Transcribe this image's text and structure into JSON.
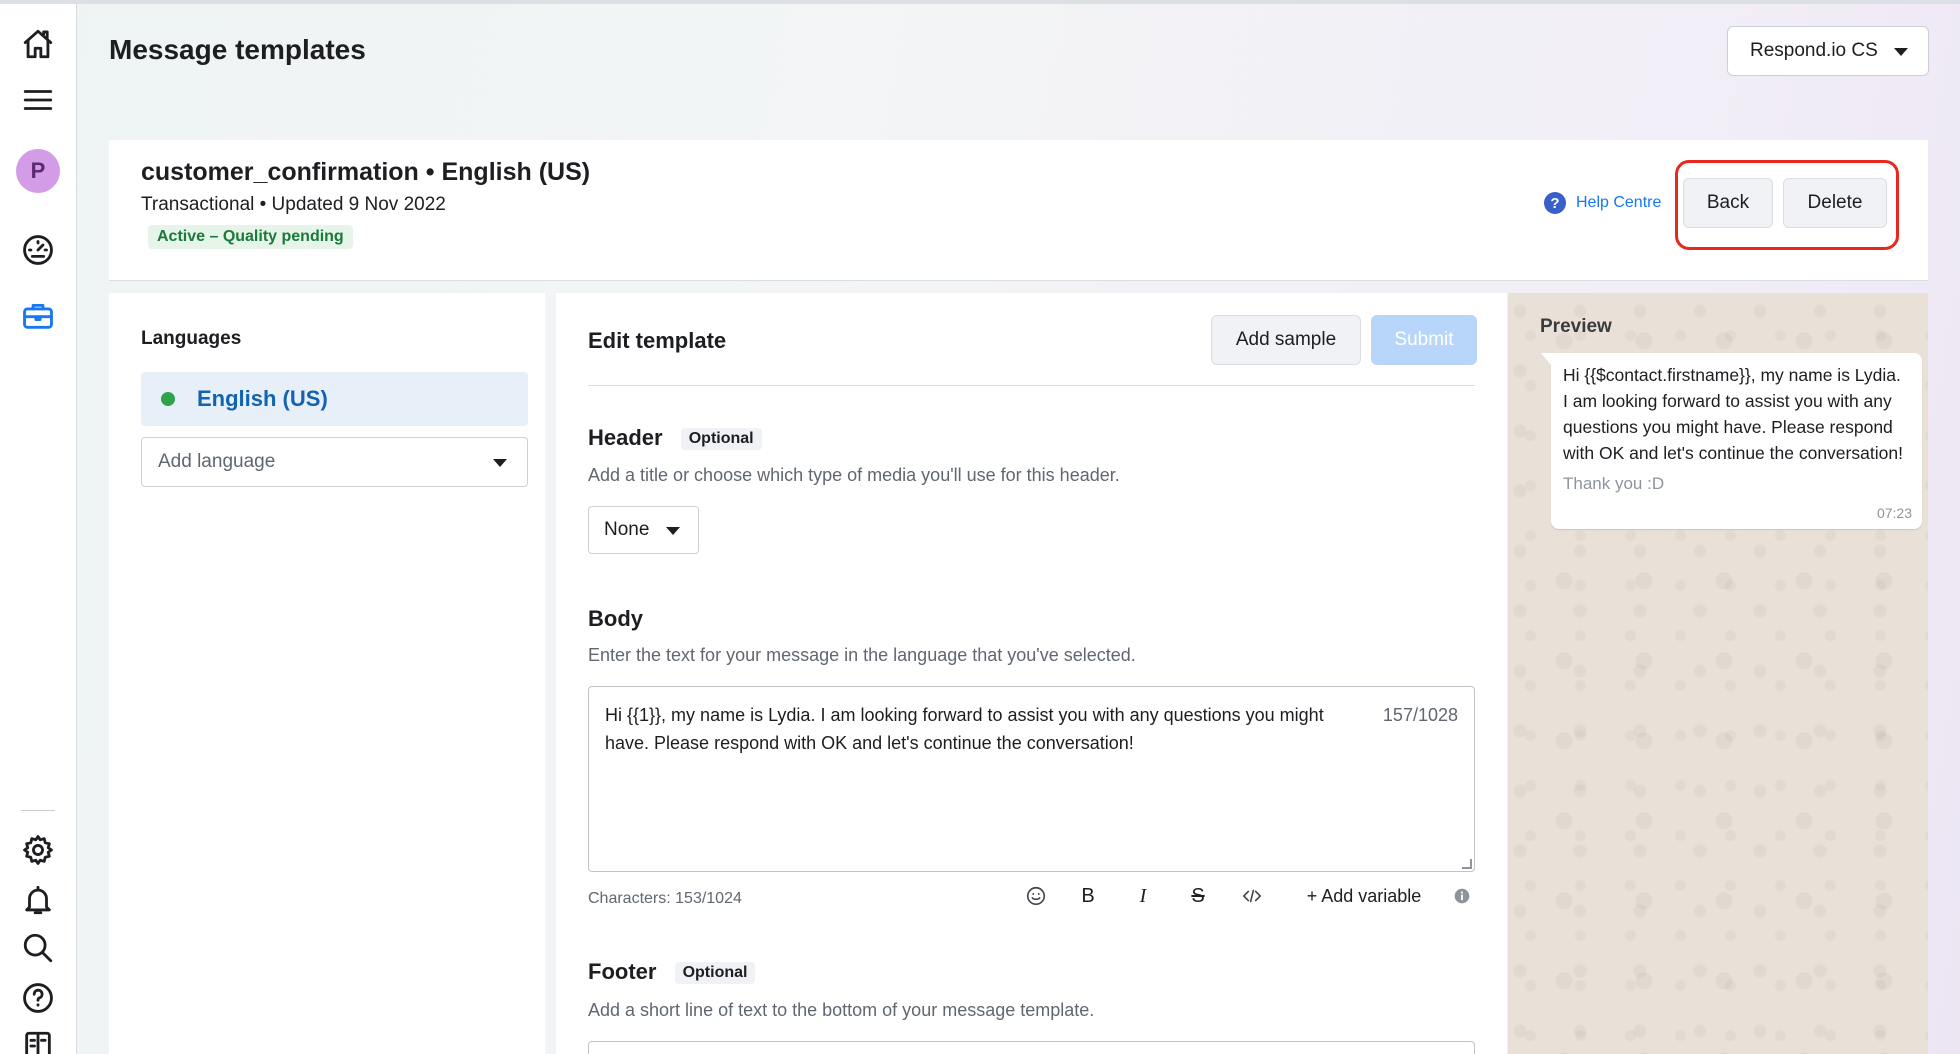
{
  "page": {
    "title": "Message templates"
  },
  "account_selector": {
    "label": "Respond.io CS"
  },
  "rail": {
    "avatar_letter": "P",
    "icons": [
      "home-icon",
      "menu-icon",
      "gauge-icon",
      "briefcase-icon",
      "gear-icon",
      "bell-icon",
      "search-icon",
      "help-icon",
      "book-icon"
    ]
  },
  "template": {
    "name": "customer_confirmation • English (US)",
    "meta": "Transactional • Updated 9 Nov 2022",
    "status": "Active – Quality pending",
    "help_label": "Help Centre",
    "help_glyph": "?",
    "back_label": "Back",
    "delete_label": "Delete",
    "highlight_color": "#e8281c"
  },
  "languages": {
    "label": "Languages",
    "items": [
      {
        "label": "English (US)",
        "status_color": "#31a24c"
      }
    ],
    "add_placeholder": "Add language"
  },
  "editor": {
    "title": "Edit template",
    "add_sample_label": "Add sample",
    "submit_label": "Submit",
    "header": {
      "title": "Header",
      "optional": "Optional",
      "description": "Add a title or choose which type of media you'll use for this header.",
      "media_type": "None"
    },
    "body": {
      "title": "Body",
      "description": "Enter the text for your message in the language that you've selected.",
      "text": "Hi {{1}}, my name is Lydia. I am looking forward to assist you with any questions you might have. Please respond with OK and let's continue the conversation!",
      "counter": "157/1028",
      "characters": "Characters: 153/1024",
      "bold_glyph": "B",
      "italic_glyph": "I",
      "strike_glyph": "S",
      "add_variable_label": "+ Add variable"
    },
    "footer": {
      "title": "Footer",
      "optional": "Optional",
      "description": "Add a short line of text to the bottom of your message template."
    }
  },
  "preview": {
    "label": "Preview",
    "message": "Hi {{$contact.firstname}}, my name is Lydia. I am looking forward to assist you with any questions you might have. Please respond with OK and let's continue the conversation!",
    "footer": "Thank you :D",
    "time": "07:23"
  },
  "colors": {
    "accent": "#1877f2",
    "submit_disabled": "#b8d6f9",
    "badge_bg": "#e6f4ea",
    "badge_text": "#1a7a37"
  }
}
